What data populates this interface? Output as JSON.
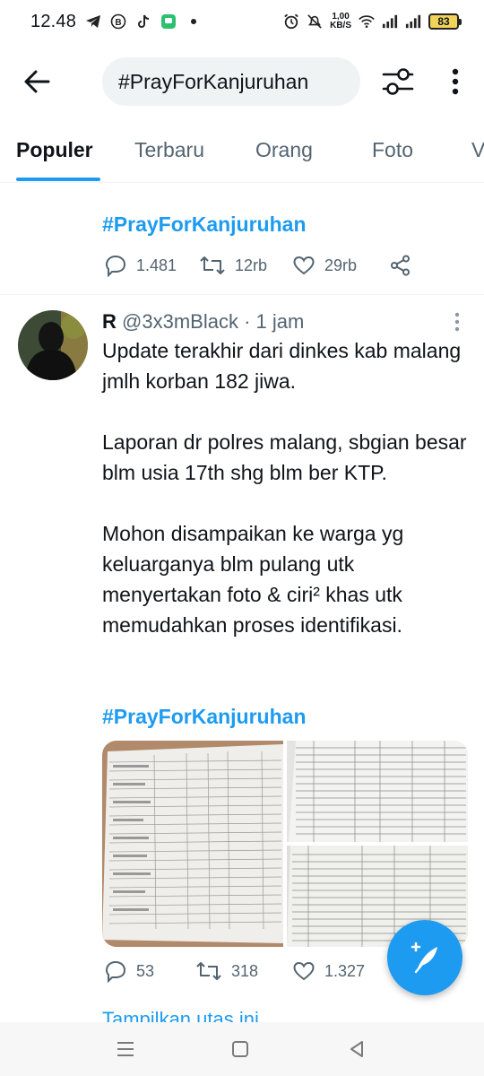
{
  "status_bar": {
    "time": "12.48",
    "net_speed_value": "1,00",
    "net_speed_unit": "KB/S",
    "battery": "83"
  },
  "header": {
    "search_value": "#PrayForKanjuruhan"
  },
  "tabs": [
    {
      "label": "Populer",
      "active": true
    },
    {
      "label": "Terbaru",
      "active": false
    },
    {
      "label": "Orang",
      "active": false
    },
    {
      "label": "Foto",
      "active": false
    },
    {
      "label": "V",
      "active": false
    }
  ],
  "trend": {
    "hashtag": "#PrayForKanjuruhan",
    "replies": "1.481",
    "retweets": "12rb",
    "likes": "29rb"
  },
  "tweet": {
    "name": "R",
    "handle": "@3x3mBlack",
    "separator": "·",
    "time": "1 jam",
    "paragraphs": [
      "Update terakhir dari dinkes kab malang jmlh korban 182 jiwa.",
      "Laporan dr polres malang, sbgian besar blm usia 17th shg blm ber KTP.",
      "Mohon disampaikan ke warga yg keluarganya blm pulang utk menyertakan foto & ciri² khas utk memudahkan proses identifikasi."
    ],
    "hashtag": "#PrayForKanjuruhan",
    "replies": "53",
    "retweets": "318",
    "likes": "1.327",
    "show_thread": "Tampilkan utas ini"
  },
  "colors": {
    "accent": "#1d9bf0",
    "text_primary": "#0f1419",
    "text_secondary": "#536471",
    "search_bg": "#eff3f4"
  },
  "icons": {
    "back": "arrow-left-icon",
    "filter": "sliders-icon",
    "more": "more-vertical-icon",
    "reply": "chat-bubble-icon",
    "retweet": "retweet-icon",
    "like": "heart-icon",
    "share": "share-icon",
    "compose": "feather-plus-icon"
  }
}
